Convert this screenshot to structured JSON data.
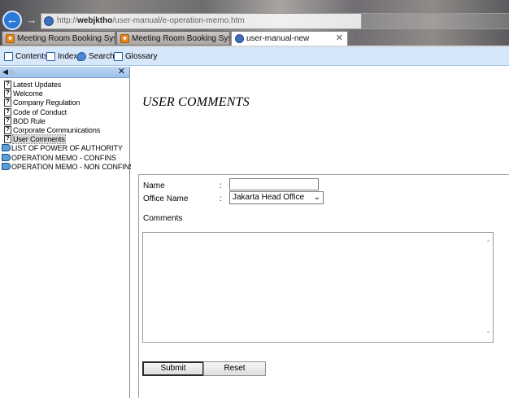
{
  "browser": {
    "url_prefix": "http://",
    "url_host": "webjktho",
    "url_path": "/user-manual/e-operation-memo.htm",
    "tabs": [
      {
        "label": "Meeting Room Booking System",
        "active": false
      },
      {
        "label": "Meeting Room Booking System",
        "active": false
      },
      {
        "label": "user-manual-new",
        "active": true
      }
    ],
    "tab_close_glyph": "✕"
  },
  "help_toolbar": {
    "contents": "Contents",
    "index": "Index",
    "search": "Search",
    "glossary": "Glossary"
  },
  "nav": {
    "items": [
      {
        "label": "Latest Updates",
        "type": "topic"
      },
      {
        "label": "Welcome",
        "type": "topic"
      },
      {
        "label": "Company Regulation",
        "type": "topic"
      },
      {
        "label": "Code of Conduct",
        "type": "topic"
      },
      {
        "label": "BOD Rule",
        "type": "topic"
      },
      {
        "label": "Corporate Communications",
        "type": "topic"
      },
      {
        "label": "User Comments",
        "type": "topic",
        "selected": true
      },
      {
        "label": "LIST OF POWER OF AUTHORITY",
        "type": "book"
      },
      {
        "label": "OPERATION MEMO - CONFINS",
        "type": "book"
      },
      {
        "label": "OPERATION MEMO - NON CONFINS",
        "type": "book"
      }
    ]
  },
  "page": {
    "title": "USER COMMENTS"
  },
  "form": {
    "name_label": "Name",
    "colon": ":",
    "name_value": "",
    "office_label": "Office Name",
    "office_selected": "Jakarta Head Office",
    "comments_label": "Comments",
    "comments_value": "",
    "submit_label": "Submit",
    "reset_label": "Reset"
  },
  "colors": {
    "toolbar_bg": "#d6e7fa",
    "back_button": "#2b79d6",
    "tab_favicon": "#e8871c"
  }
}
